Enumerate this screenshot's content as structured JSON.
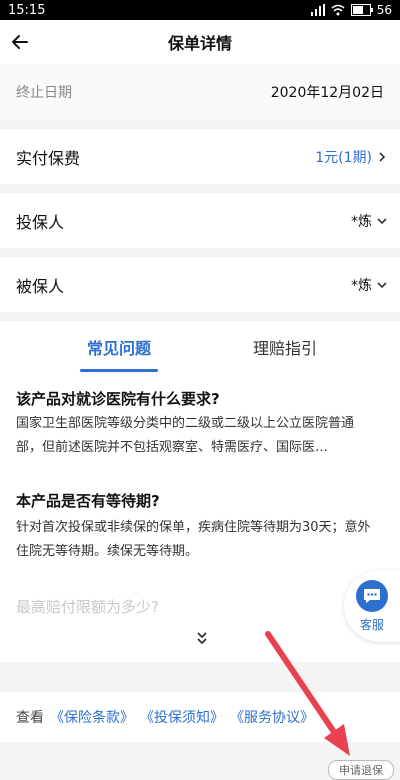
{
  "status": {
    "time": "15:15",
    "battery": "56"
  },
  "header": {
    "title": "保单详情"
  },
  "end_date": {
    "label": "终止日期",
    "value": "2020年12月02日"
  },
  "rows": [
    {
      "label": "实付保费",
      "value": "1元(1期)"
    },
    {
      "label": "投保人",
      "value": "*炼"
    },
    {
      "label": "被保人",
      "value": "*炼"
    }
  ],
  "tabs": [
    {
      "label": "常见问题",
      "active": true
    },
    {
      "label": "理赔指引",
      "active": false
    }
  ],
  "faq": [
    {
      "question": "该产品对就诊医院有什么要求?",
      "answer": "国家卫生部医院等级分类中的二级或二级以上公立医院普通部，但前述医院并不包括观察室、特需医疗、国际医…"
    },
    {
      "question": "本产品是否有等待期?",
      "answer": "针对首次投保或非续保的保单，疾病住院等待期为30天；意外住院无等待期。续保无等待期。"
    },
    {
      "question": "最高赔付限额为多少?"
    }
  ],
  "service": {
    "label": "客服"
  },
  "links": {
    "prefix": "查看",
    "items": [
      "《保险条款》",
      "《投保须知》",
      "《服务协议》"
    ]
  },
  "refund_label": "申请退保",
  "colors": {
    "accent": "#2f6fd0",
    "annotation": "#e8424e"
  }
}
